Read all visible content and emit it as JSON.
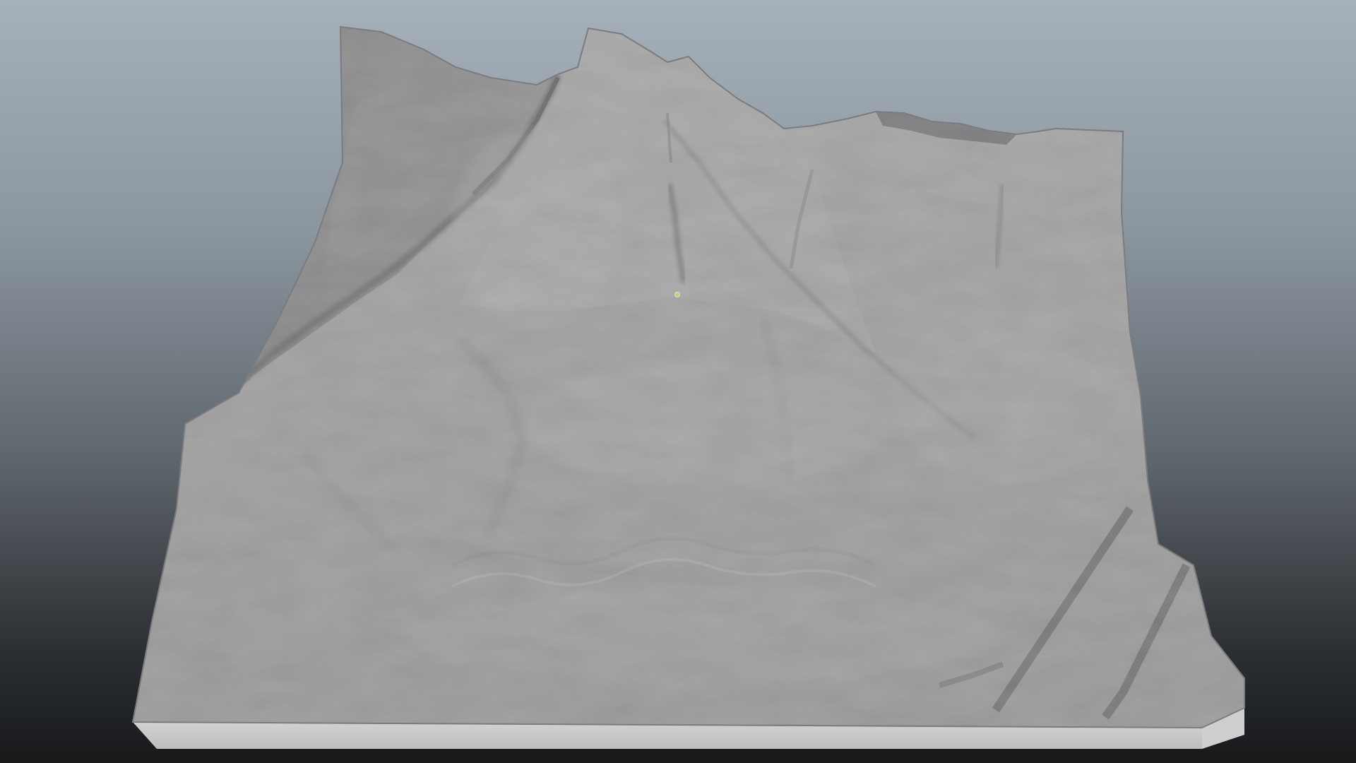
{
  "viewport": {
    "background_top": "#a6b0ba",
    "background_bottom": "#17191b"
  },
  "terrain": {
    "object": "terrain-heightfield",
    "surface_color": "#a4a4a4",
    "highlight_color": "#c6c6c6",
    "shadow_color": "#4a4a4d",
    "base_front_color": "#cbcbcb",
    "base_side_color": "#d8d8d8"
  },
  "pivot": {
    "icon": "pivot-point-icon",
    "color": "#e9e2a8"
  }
}
